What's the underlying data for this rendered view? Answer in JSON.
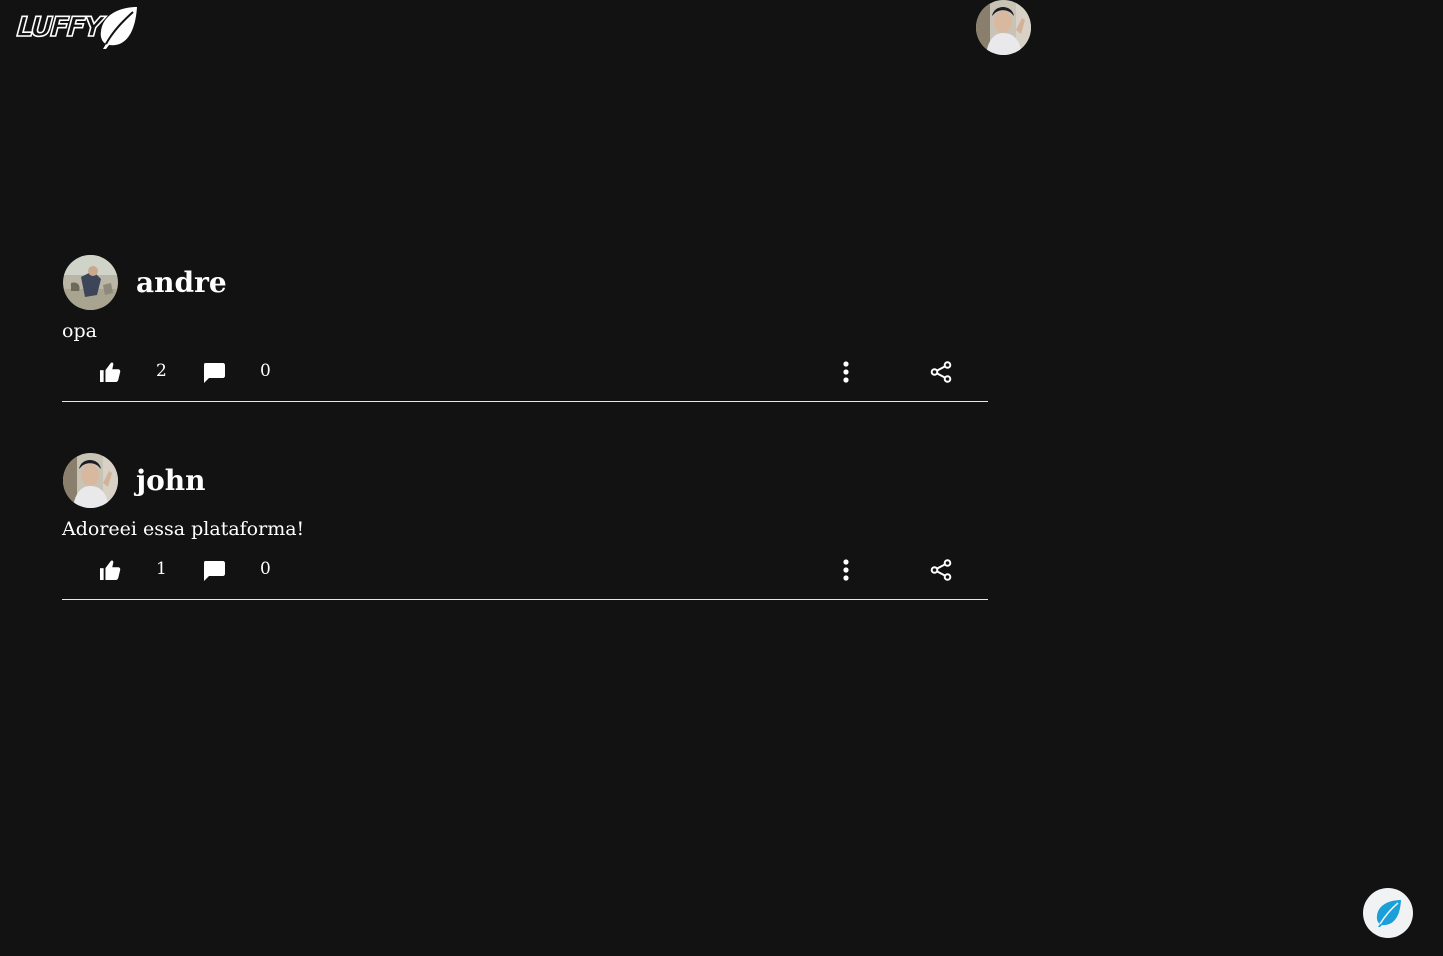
{
  "app": {
    "logo_text": "LUFFY",
    "brand_color": "#1a9fd8",
    "background": "#121212"
  },
  "header": {
    "avatar_icon": "user-avatar-photo"
  },
  "posts": [
    {
      "author": "andre",
      "text": "opa",
      "likes": "2",
      "comments": "0"
    },
    {
      "author": "john",
      "text": "Adoreei essa plataforma!",
      "likes": "1",
      "comments": "0"
    }
  ],
  "icons": {
    "like": "thumb-up-icon",
    "comment": "comment-icon",
    "more": "more-vertical-icon",
    "share": "share-icon",
    "compose": "leaf-icon"
  }
}
